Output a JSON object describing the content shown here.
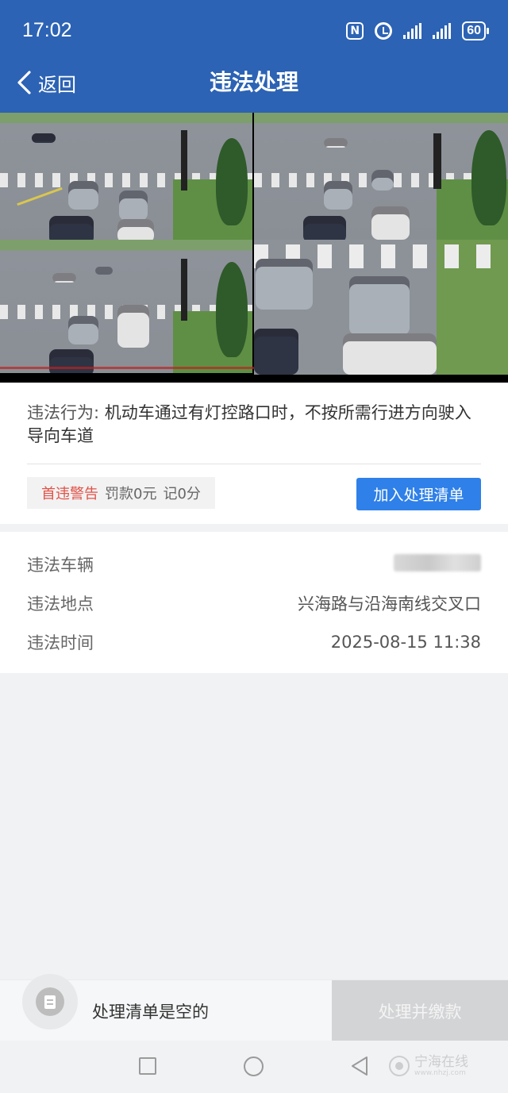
{
  "status_bar": {
    "time": "17:02",
    "battery": "60",
    "icons": [
      "nfc-icon",
      "alarm-icon",
      "signal-icon",
      "signal-icon",
      "battery-icon"
    ]
  },
  "header": {
    "back_label": "返回",
    "title": "违法处理"
  },
  "photos": {
    "count": 2,
    "active_index": 0
  },
  "violation": {
    "behavior_label": "违法行为:",
    "behavior_text": "机动车通过有灯控路口时，不按所需行进方向驶入导向车道",
    "warning": "首违警告",
    "fine": "罚款0元",
    "points": "记0分",
    "add_button": "加入处理清单"
  },
  "details": {
    "vehicle_label": "违法车辆",
    "vehicle_value": "浙B525D",
    "location_label": "违法地点",
    "location_value": "兴海路与沿海南线交叉口",
    "time_label": "违法时间",
    "time_value": "2025-08-15 11:38"
  },
  "bottom_bar": {
    "empty_text": "处理清单是空的",
    "pay_button": "处理并缴款"
  },
  "watermark": {
    "text": "宁海在线",
    "sub": "www.nhzj.com"
  },
  "colors": {
    "header_bg": "#2c63b4",
    "button_blue": "#2f80e8",
    "warning_red": "#e05348",
    "disabled_gray": "#d3d4d6"
  }
}
